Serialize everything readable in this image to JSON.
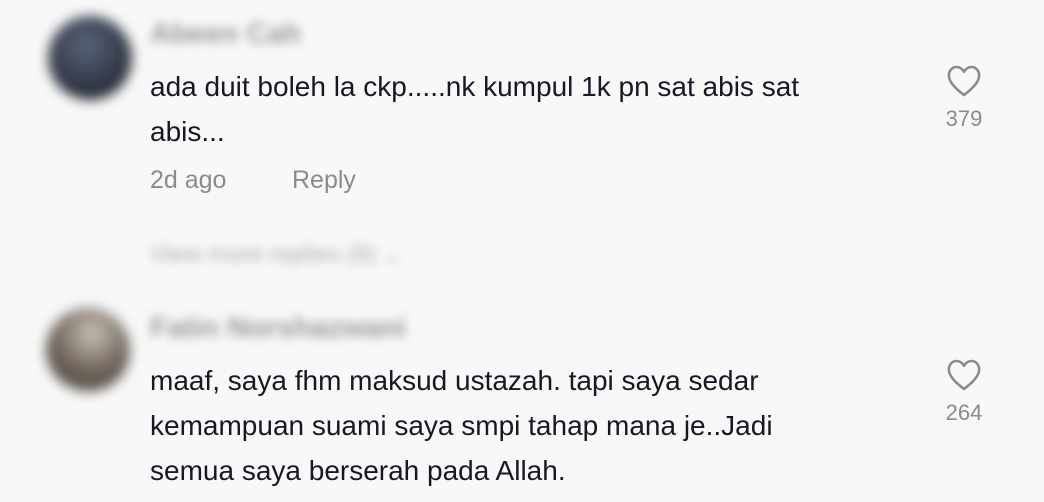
{
  "comments": [
    {
      "username": "Abeen Cah",
      "text": "ada duit boleh la ckp.....nk kumpul 1k pn sat abis sat\nabis...",
      "time": "2d ago",
      "reply_label": "Reply",
      "likes": "379",
      "like_icon": "heart-outline-icon",
      "view_replies": "View more replies (8) ⌄"
    },
    {
      "username": "Fatin Norshazwani",
      "text": "maaf, saya fhm maksud ustazah. tapi saya sedar\nkemampuan suami saya smpi tahap mana je..Jadi\nsemua saya berserah pada Allah.",
      "likes": "264",
      "like_icon": "heart-outline-icon"
    }
  ],
  "colors": {
    "background": "#f8f8f8",
    "text": "#161823",
    "secondary": "#8a8b91"
  }
}
